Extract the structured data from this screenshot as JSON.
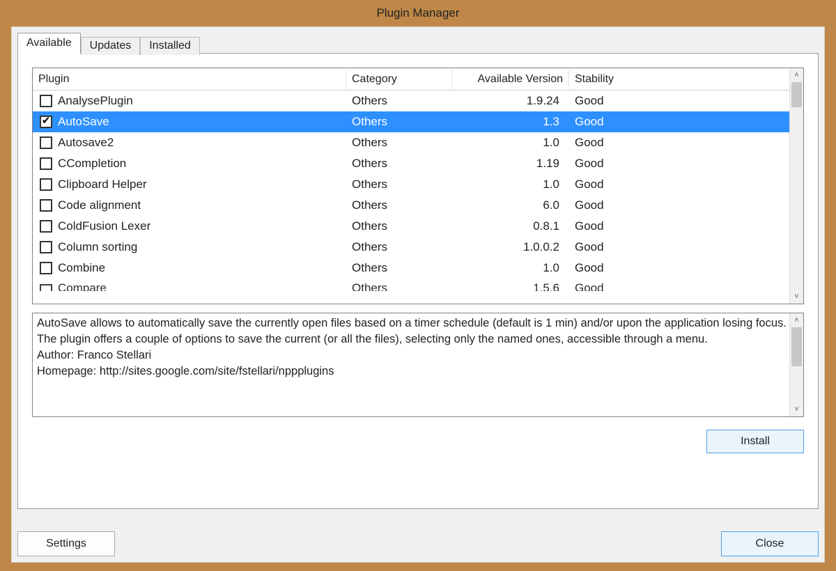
{
  "title": "Plugin Manager",
  "tabs": [
    {
      "label": "Available",
      "active": true
    },
    {
      "label": "Updates",
      "active": false
    },
    {
      "label": "Installed",
      "active": false
    }
  ],
  "columns": {
    "plugin": "Plugin",
    "category": "Category",
    "version": "Available Version",
    "stability": "Stability"
  },
  "plugins": [
    {
      "name": "AnalysePlugin",
      "category": "Others",
      "version": "1.9.24",
      "stability": "Good",
      "checked": false,
      "selected": false
    },
    {
      "name": "AutoSave",
      "category": "Others",
      "version": "1.3",
      "stability": "Good",
      "checked": true,
      "selected": true
    },
    {
      "name": "Autosave2",
      "category": "Others",
      "version": "1.0",
      "stability": "Good",
      "checked": false,
      "selected": false
    },
    {
      "name": "CCompletion",
      "category": "Others",
      "version": "1.19",
      "stability": "Good",
      "checked": false,
      "selected": false
    },
    {
      "name": "Clipboard Helper",
      "category": "Others",
      "version": "1.0",
      "stability": "Good",
      "checked": false,
      "selected": false
    },
    {
      "name": "Code alignment",
      "category": "Others",
      "version": "6.0",
      "stability": "Good",
      "checked": false,
      "selected": false
    },
    {
      "name": "ColdFusion Lexer",
      "category": "Others",
      "version": "0.8.1",
      "stability": "Good",
      "checked": false,
      "selected": false
    },
    {
      "name": "Column sorting",
      "category": "Others",
      "version": "1.0.0.2",
      "stability": "Good",
      "checked": false,
      "selected": false
    },
    {
      "name": "Combine",
      "category": "Others",
      "version": "1.0",
      "stability": "Good",
      "checked": false,
      "selected": false
    },
    {
      "name": "Compare",
      "category": "Others",
      "version": "1.5.6",
      "stability": "Good",
      "checked": false,
      "selected": false,
      "partial": true
    }
  ],
  "description": {
    "text": "AutoSave allows to automatically save the currently open files based on a timer schedule (default is 1 min) and/or upon the application losing focus. The plugin offers a couple of options to save the current (or all the files), selecting only the named ones, accessible through a menu.",
    "author_line": "Author: Franco Stellari",
    "homepage_line": "Homepage: http://sites.google.com/site/fstellari/nppplugins"
  },
  "buttons": {
    "install": "Install",
    "settings": "Settings",
    "close": "Close"
  },
  "scroll_glyphs": {
    "up": "˄",
    "down": "˅"
  }
}
